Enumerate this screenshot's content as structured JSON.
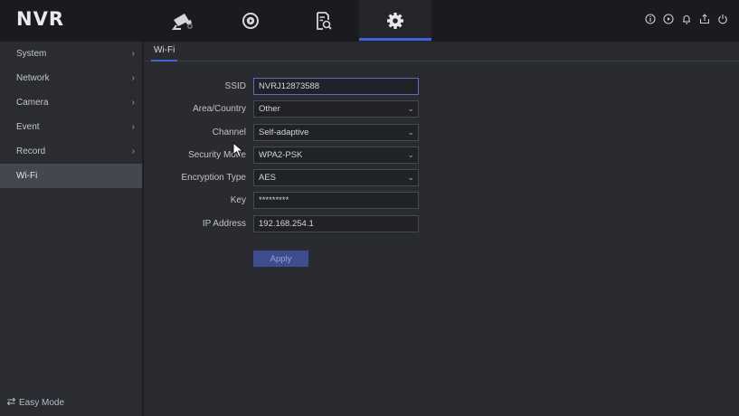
{
  "app": {
    "logo": "NVR"
  },
  "nav_tabs": [
    {
      "icon": "camera-icon",
      "active": false
    },
    {
      "icon": "playback-icon",
      "active": false
    },
    {
      "icon": "file-search-icon",
      "active": false
    },
    {
      "icon": "gear-icon",
      "active": true
    }
  ],
  "top_icons": [
    "info-icon",
    "record-icon",
    "alarm-icon",
    "export-icon",
    "power-icon"
  ],
  "sidebar": {
    "items": [
      {
        "label": "System",
        "chevron": "›"
      },
      {
        "label": "Network",
        "chevron": "›"
      },
      {
        "label": "Camera",
        "chevron": "›"
      },
      {
        "label": "Event",
        "chevron": "›"
      },
      {
        "label": "Record",
        "chevron": "›"
      },
      {
        "label": "Wi-Fi",
        "chevron": ""
      }
    ],
    "easy_mode": "Easy Mode"
  },
  "content": {
    "tab": "Wi-Fi",
    "fields": [
      {
        "label": "SSID",
        "value": "NVRJ12873588"
      },
      {
        "label": "Area/Country",
        "value": "Other"
      },
      {
        "label": "Channel",
        "value": "Self-adaptive"
      },
      {
        "label": "Security Mode",
        "value": "WPA2-PSK"
      },
      {
        "label": "Encryption Type",
        "value": "AES"
      },
      {
        "label": "Key",
        "value": "*********"
      },
      {
        "label": "IP Address",
        "value": "192.168.254.1"
      }
    ],
    "apply_label": "Apply"
  },
  "colors": {
    "accent": "#3f62d6",
    "button": "#3f4c8d"
  }
}
